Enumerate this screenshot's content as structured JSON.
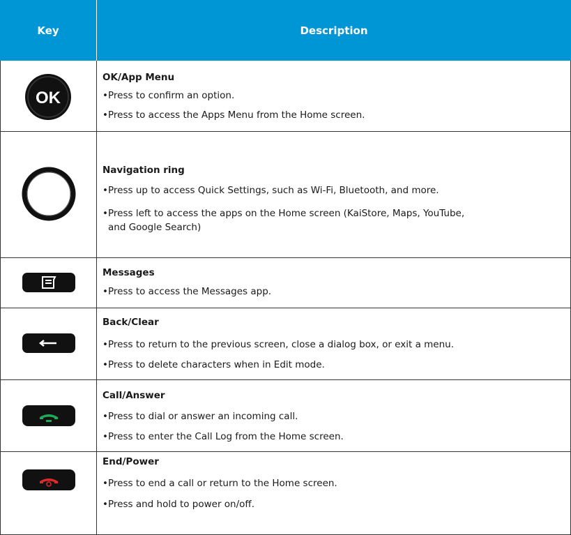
{
  "header": {
    "key": "Key",
    "description": "Description"
  },
  "rows": [
    {
      "icon": "ok-button-icon",
      "icon_text": "OK",
      "title": "OK/App Menu",
      "bullets": [
        "Press to confirm an option.",
        "Press to access the Apps Menu from the Home screen."
      ]
    },
    {
      "icon": "navigation-ring-icon",
      "title": "Navigation ring",
      "bullets": [
        "Press up to access Quick Settings, such as Wi-Fi, Bluetooth, and more.",
        "Press left to access the apps on the Home screen (KaiStore, Maps, YouTube,",
        "and Google Search)"
      ]
    },
    {
      "icon": "messages-key-icon",
      "title": "Messages",
      "bullets": [
        "Press to access the Messages app."
      ]
    },
    {
      "icon": "back-clear-key-icon",
      "title": "Back/Clear",
      "bullets": [
        "Press to return to the previous screen, close a dialog box, or exit a menu.",
        "Press to delete characters when in Edit mode."
      ]
    },
    {
      "icon": "call-answer-key-icon",
      "title": "Call/Answer",
      "bullets": [
        "Press to dial or answer an incoming call.",
        "Press to enter the Call Log from the Home screen."
      ]
    },
    {
      "icon": "end-power-key-icon",
      "title": "End/Power",
      "bullets": [
        "Press to end a call or return to the Home screen.",
        "Press and hold to power on/off."
      ]
    }
  ],
  "bullet_char": "•",
  "colors": {
    "header_bg": "#0096d6",
    "call_green": "#1faa59",
    "end_red": "#e02a2a"
  }
}
